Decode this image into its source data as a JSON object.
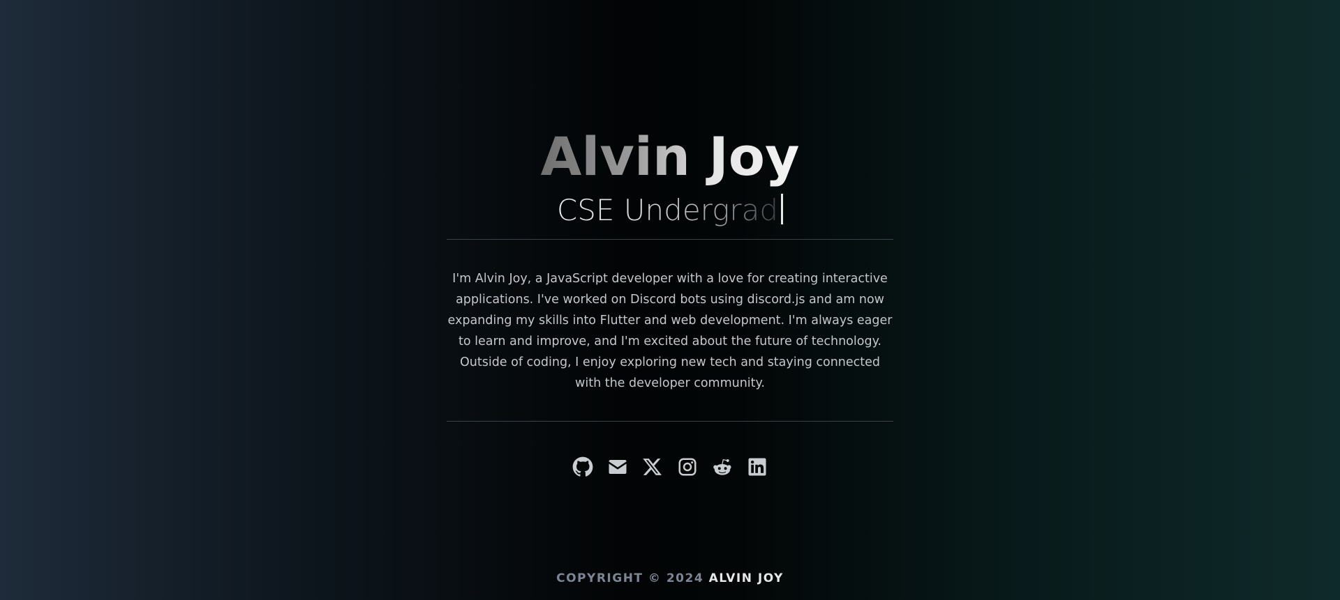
{
  "profile": {
    "name": "Alvin Joy",
    "role": "CSE Undergrad",
    "bio": "I'm Alvin Joy, a JavaScript developer with a love for creating interactive applications. I've worked on Discord bots using discord.js and am now expanding my skills into Flutter and web development. I'm always eager to learn and improve, and I'm excited about the future of technology. Outside of coding, I enjoy exploring new tech and staying connected with the developer community."
  },
  "socials": [
    {
      "icon": "github-icon"
    },
    {
      "icon": "envelope-icon"
    },
    {
      "icon": "x-twitter-icon"
    },
    {
      "icon": "instagram-icon"
    },
    {
      "icon": "reddit-icon"
    },
    {
      "icon": "linkedin-icon"
    }
  ],
  "footer": {
    "copyright": "COPYRIGHT © 2024",
    "owner": "ALVIN JOY"
  },
  "colors": {
    "text": "#c9ccd0",
    "rule": "#3b4248",
    "footer_dim": "#7c8694"
  }
}
